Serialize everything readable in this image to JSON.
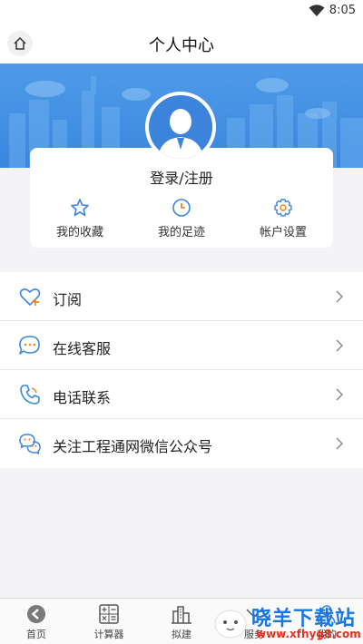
{
  "status_bar": {
    "time": "8:05",
    "wifi_icon": "wifi-icon"
  },
  "header": {
    "title": "个人中心",
    "home_icon": "home-icon"
  },
  "profile": {
    "login_label": "登录/注册",
    "quick_actions": [
      {
        "label": "我的收藏",
        "icon": "star-icon"
      },
      {
        "label": "我的足迹",
        "icon": "clock-icon"
      },
      {
        "label": "帐户设置",
        "icon": "gear-icon"
      }
    ]
  },
  "menu": {
    "items": [
      {
        "label": "订阅",
        "icon": "subscribe-heart-icon"
      },
      {
        "label": "在线客服",
        "icon": "chat-bubble-icon"
      },
      {
        "label": "电话联系",
        "icon": "phone-icon"
      },
      {
        "label": "关注工程通网微信公众号",
        "icon": "wechat-icon"
      }
    ]
  },
  "tab_bar": {
    "tabs": [
      {
        "label": "首页",
        "icon": "back-arrow-icon"
      },
      {
        "label": "计算器",
        "icon": "calculator-icon"
      },
      {
        "label": "拟建",
        "icon": "building-icon"
      },
      {
        "label": "服务",
        "icon": "service-icon"
      },
      {
        "label": "我的",
        "icon": "user-icon"
      }
    ]
  },
  "watermark": {
    "text": "晓羊下载站",
    "url": "www.xfhyg8.com"
  },
  "colors": {
    "accent": "#3d87dd",
    "icon_orange": "#f08a24",
    "brand_watermark": "#1977e0"
  }
}
